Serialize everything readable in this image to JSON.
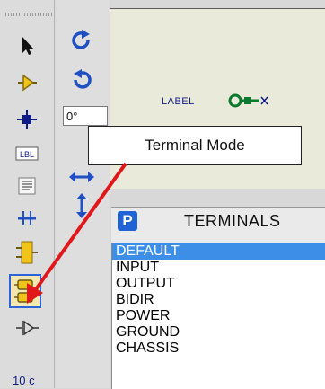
{
  "callout": {
    "text": "Terminal Mode"
  },
  "rotation": {
    "angle_value": "0°"
  },
  "canvas": {
    "label_text": "LABEL"
  },
  "terminals_panel": {
    "button_letter": "P",
    "title": "TERMINALS",
    "items": [
      "DEFAULT",
      "INPUT",
      "OUTPUT",
      "BIDIR",
      "POWER",
      "GROUND",
      "CHASSIS"
    ],
    "selected_index": 0
  },
  "toolbar": {
    "bus_label_partial": "10 c",
    "tools": [
      "select-arrow-icon",
      "component-mode-icon",
      "junction-dot-icon",
      "wire-label-icon",
      "text-script-icon",
      "bus-icon",
      "subcircuit-icon",
      "terminal-mode-icon",
      "device-pin-icon"
    ]
  },
  "colors": {
    "accent_blue": "#2b63d9",
    "selection_blue": "#3d8ee6",
    "arrow_red": "#e0181b",
    "canvas_bg": "#eaeadb",
    "icon_green": "#0a7a2e"
  }
}
